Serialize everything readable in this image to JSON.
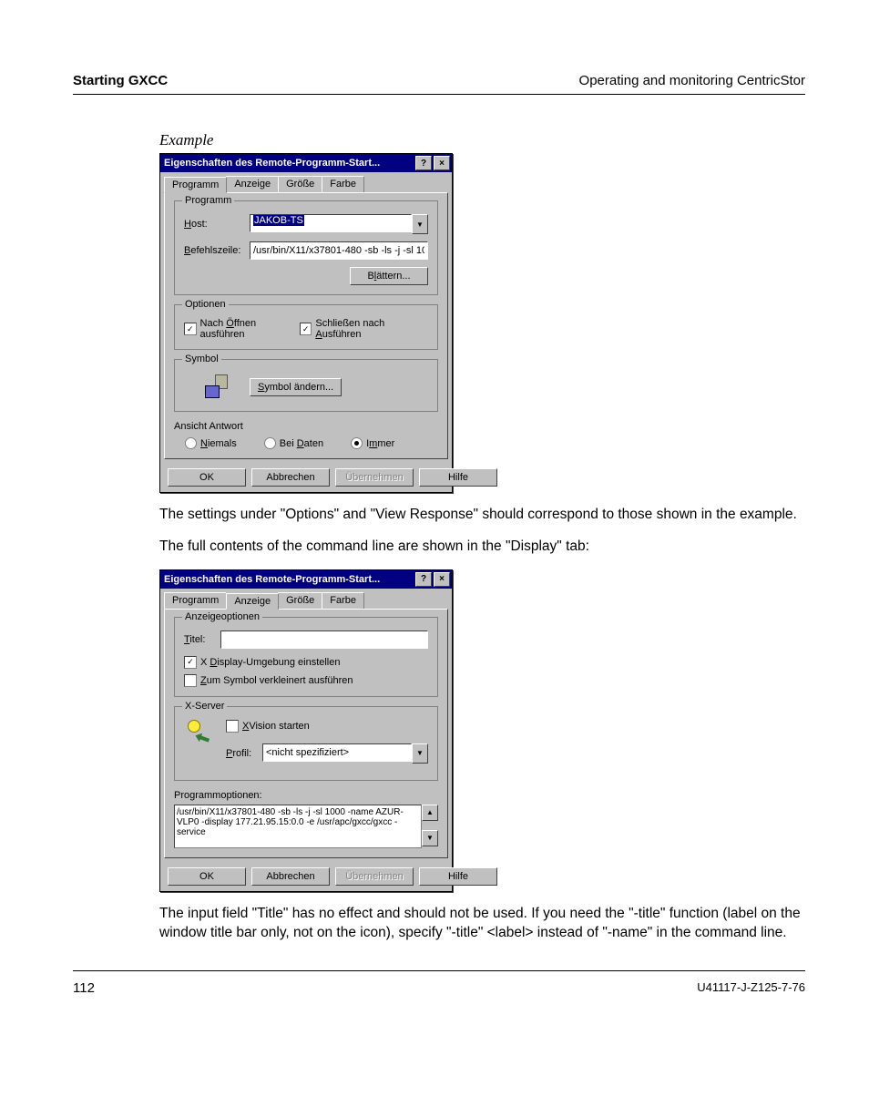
{
  "header": {
    "left": "Starting GXCC",
    "right": "Operating and monitoring CentricStor"
  },
  "example_label": "Example",
  "dialog1": {
    "title": "Eigenschaften des Remote-Programm-Start...",
    "tabs": [
      "Programm",
      "Anzeige",
      "Größe",
      "Farbe"
    ],
    "group_programm": "Programm",
    "host_label": "Host:",
    "host_value": "JAKOB-TS",
    "befehl_label": "Befehlszeile:",
    "befehl_value": "/usr/bin/X11/x37801-480 -sb -ls -j -sl 10",
    "blattern": "Blättern...",
    "group_optionen": "Optionen",
    "opt1": "Nach Öffnen ausführen",
    "opt2": "Schließen nach Ausführen",
    "group_symbol": "Symbol",
    "symbol_btn": "Symbol ändern...",
    "group_ansicht": "Ansicht Antwort",
    "radio1": "Niemals",
    "radio2": "Bei Daten",
    "radio3": "Immer",
    "ok": "OK",
    "cancel": "Abbrechen",
    "apply": "Übernehmen",
    "help": "Hilfe"
  },
  "para1": "The settings under \"Options\" and \"View Response\" should correspond to those shown in the example.",
  "para2": "The full contents of the command line are shown in the \"Display\" tab:",
  "dialog2": {
    "title": "Eigenschaften des Remote-Programm-Start...",
    "tabs": [
      "Programm",
      "Anzeige",
      "Größe",
      "Farbe"
    ],
    "group_anzeige": "Anzeigeoptionen",
    "titel_label": "Titel:",
    "chk1": "X Display-Umgebung einstellen",
    "chk2": "Zum Symbol verkleinert ausführen",
    "group_xserver": "X-Server",
    "xvision": "XVision starten",
    "profil_label": "Profil:",
    "profil_value": "<nicht spezifiziert>",
    "group_prog": "Programmoptionen:",
    "progtext": "/usr/bin/X11/x37801-480 -sb -ls -j -sl 1000 -name AZUR-VLP0 -display 177.21.95.15:0.0 -e /usr/apc/gxcc/gxcc -service",
    "ok": "OK",
    "cancel": "Abbrechen",
    "apply": "Übernehmen",
    "help": "Hilfe"
  },
  "para3": "The input field \"Title\" has no effect and should not be used. If you need the \"-title\" function (label on the window title bar only, not on the icon), specify \"-title\" <label> instead of \"-name\" in the command line.",
  "footer": {
    "page": "112",
    "docid": "U41117-J-Z125-7-76"
  }
}
